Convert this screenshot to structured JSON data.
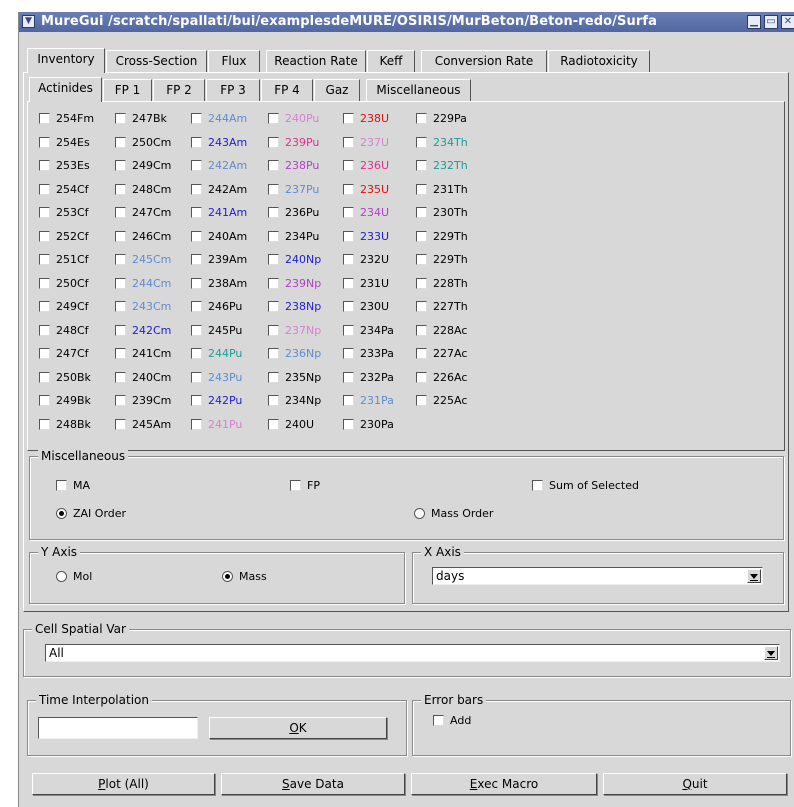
{
  "window": {
    "title": "MureGui /scratch/spallati/bui/examplesdeMURE/OSIRIS/MurBeton/Beton-redo/Surfa",
    "menu_icon": "chevron-down-icon",
    "buttons": [
      "minimize-icon",
      "maximize-icon",
      "close-icon"
    ]
  },
  "main_tabs": [
    "Inventory",
    "Cross-Section",
    "Flux",
    "Reaction Rate",
    "Keff",
    "Conversion Rate",
    "Radiotoxicity"
  ],
  "sub_tabs": [
    "Actinides",
    "FP 1",
    "FP 2",
    "FP 3",
    "FP 4",
    "Gaz",
    "Miscellaneous"
  ],
  "colors": {
    "default": "#000000",
    "blue": "#2020d0",
    "lightblue": "#5f8cd0",
    "red": "#e01010",
    "pink": "#e0308c",
    "magenta": "#b040c8",
    "lightpink": "#d880d0",
    "teal": "#1e9a9a"
  },
  "isotopes": [
    [
      [
        "254Fm",
        "default"
      ],
      [
        "254Es",
        "default"
      ],
      [
        "253Es",
        "default"
      ],
      [
        "254Cf",
        "default"
      ],
      [
        "253Cf",
        "default"
      ],
      [
        "252Cf",
        "default"
      ],
      [
        "251Cf",
        "default"
      ],
      [
        "250Cf",
        "default"
      ],
      [
        "249Cf",
        "default"
      ],
      [
        "248Cf",
        "default"
      ],
      [
        "247Cf",
        "default"
      ],
      [
        "250Bk",
        "default"
      ],
      [
        "249Bk",
        "default"
      ],
      [
        "248Bk",
        "default"
      ]
    ],
    [
      [
        "247Bk",
        "default"
      ],
      [
        "250Cm",
        "default"
      ],
      [
        "249Cm",
        "default"
      ],
      [
        "248Cm",
        "default"
      ],
      [
        "247Cm",
        "default"
      ],
      [
        "246Cm",
        "default"
      ],
      [
        "245Cm",
        "lightblue"
      ],
      [
        "244Cm",
        "lightblue"
      ],
      [
        "243Cm",
        "lightblue"
      ],
      [
        "242Cm",
        "blue"
      ],
      [
        "241Cm",
        "default"
      ],
      [
        "240Cm",
        "default"
      ],
      [
        "239Cm",
        "default"
      ],
      [
        "245Am",
        "default"
      ]
    ],
    [
      [
        "244Am",
        "lightblue"
      ],
      [
        "243Am",
        "blue"
      ],
      [
        "242Am",
        "lightblue"
      ],
      [
        "242Am",
        "default"
      ],
      [
        "241Am",
        "blue"
      ],
      [
        "240Am",
        "default"
      ],
      [
        "239Am",
        "default"
      ],
      [
        "238Am",
        "default"
      ],
      [
        "246Pu",
        "default"
      ],
      [
        "245Pu",
        "default"
      ],
      [
        "244Pu",
        "teal"
      ],
      [
        "243Pu",
        "lightblue"
      ],
      [
        "242Pu",
        "blue"
      ],
      [
        "241Pu",
        "lightpink"
      ]
    ],
    [
      [
        "240Pu",
        "lightpink"
      ],
      [
        "239Pu",
        "pink"
      ],
      [
        "238Pu",
        "magenta"
      ],
      [
        "237Pu",
        "lightblue"
      ],
      [
        "236Pu",
        "default"
      ],
      [
        "234Pu",
        "default"
      ],
      [
        "240Np",
        "blue"
      ],
      [
        "239Np",
        "magenta"
      ],
      [
        "238Np",
        "blue"
      ],
      [
        "237Np",
        "lightpink"
      ],
      [
        "236Np",
        "lightblue"
      ],
      [
        "235Np",
        "default"
      ],
      [
        "234Np",
        "default"
      ],
      [
        "240U",
        "default"
      ]
    ],
    [
      [
        "238U",
        "red"
      ],
      [
        "237U",
        "lightpink"
      ],
      [
        "236U",
        "pink"
      ],
      [
        "235U",
        "red"
      ],
      [
        "234U",
        "magenta"
      ],
      [
        "233U",
        "blue"
      ],
      [
        "232U",
        "default"
      ],
      [
        "231U",
        "default"
      ],
      [
        "230U",
        "default"
      ],
      [
        "234Pa",
        "default"
      ],
      [
        "233Pa",
        "default"
      ],
      [
        "232Pa",
        "default"
      ],
      [
        "231Pa",
        "lightblue"
      ],
      [
        "230Pa",
        "default"
      ]
    ],
    [
      [
        "229Pa",
        "default"
      ],
      [
        "234Th",
        "teal"
      ],
      [
        "232Th",
        "teal"
      ],
      [
        "231Th",
        "default"
      ],
      [
        "230Th",
        "default"
      ],
      [
        "229Th",
        "default"
      ],
      [
        "229Th",
        "default"
      ],
      [
        "228Th",
        "default"
      ],
      [
        "227Th",
        "default"
      ],
      [
        "228Ac",
        "default"
      ],
      [
        "227Ac",
        "default"
      ],
      [
        "226Ac",
        "default"
      ],
      [
        "225Ac",
        "default"
      ]
    ]
  ],
  "misc": {
    "title": "Miscellaneous",
    "ma": "MA",
    "fp": "FP",
    "sum": "Sum of Selected",
    "zai": "ZAI Order",
    "mass_order": "Mass Order",
    "selected_order": "ZAI Order"
  },
  "y_axis": {
    "title": "Y Axis",
    "mol": "Mol",
    "mass": "Mass",
    "selected": "Mass"
  },
  "x_axis": {
    "title": "X Axis",
    "value": "days"
  },
  "cell_spatial": {
    "title": "Cell Spatial Var",
    "value": "All"
  },
  "time_interp": {
    "title": "Time Interpolation",
    "input_value": "",
    "ok_prefix": "",
    "ok_underlined": "O",
    "ok_rest": "K"
  },
  "error_bars": {
    "title": "Error bars",
    "add": "Add"
  },
  "bottom_buttons": {
    "plot": {
      "u": "P",
      "rest": "lot (All)"
    },
    "save": {
      "u": "S",
      "rest": "ave Data"
    },
    "exec": {
      "u": "E",
      "rest": "xec Macro"
    },
    "quit": {
      "u": "Q",
      "rest": "uit"
    }
  }
}
